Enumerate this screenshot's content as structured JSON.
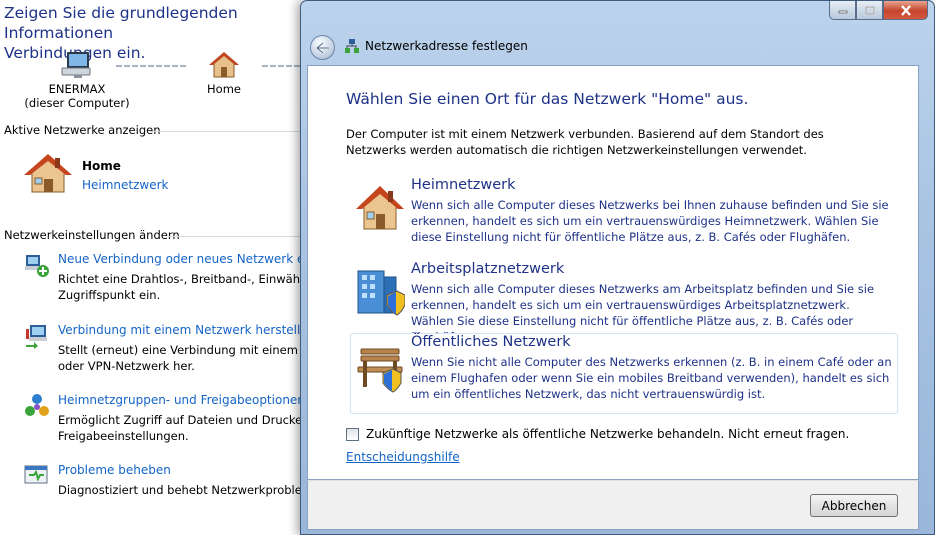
{
  "background": {
    "heading": "Zeigen Sie die grundlegenden Informationen ... Verbindungen ein.",
    "heading_line1": "Zeigen Sie die grundlegenden Informationen",
    "heading_line2": "Verbindungen ein.",
    "map": {
      "computer_name": "ENERMAX",
      "computer_sub": "(dieser Computer)",
      "network_name": "Home"
    },
    "active_networks_label": "Aktive Netzwerke anzeigen",
    "active_network": {
      "name": "Home",
      "type": "Heimnetzwerk"
    },
    "change_settings_label": "Netzwerkeinstellungen ändern",
    "tasks": [
      {
        "title": "Neue Verbindung oder neues Netzwerk einrichten",
        "line1": "Richtet eine Drahtlos-, Breitband-, Einwähl-, Ad-hoc- oder VPN-Verbindung bzw. einen Router oder",
        "line2": "Zugriffspunkt ein.",
        "icon": "new-connection-icon"
      },
      {
        "title": "Verbindung mit einem Netzwerk herstellen",
        "line1": "Stellt (erneut) eine Verbindung mit einem Drahtlos-, Kabel-, Einwähl-",
        "line2": "oder VPN-Netzwerk her.",
        "icon": "connect-network-icon"
      },
      {
        "title": "Heimnetzgruppen- und Freigabeoptionen auswählen",
        "line1": "Ermöglicht Zugriff auf Dateien und Drucker auf anderen Computern oder",
        "line2": "Freigabeeinstellungen.",
        "icon": "homegroup-icon"
      },
      {
        "title": "Probleme beheben",
        "line1": "Diagnostiziert und behebt Netzwerkprobleme,",
        "line2": "",
        "icon": "troubleshoot-icon"
      }
    ]
  },
  "dialog": {
    "caption": "Netzwerkadresse festlegen",
    "title": "Wählen Sie einen Ort für das Netzwerk \"Home\" aus.",
    "intro": "Der Computer ist mit einem Netzwerk verbunden. Basierend auf dem Standort des Netzwerks werden automatisch die richtigen Netzwerkeinstellungen verwendet.",
    "locations": [
      {
        "title": "Heimnetzwerk",
        "description": "Wenn sich alle Computer dieses Netzwerks bei Ihnen zuhause befinden und Sie sie erkennen, handelt es sich um ein vertrauenswürdiges Heimnetzwerk. Wählen Sie diese Einstellung nicht für öffentliche Plätze aus, z. B. Cafés oder Flughäfen.",
        "icon": "home-icon"
      },
      {
        "title": "Arbeitsplatznetzwerk",
        "description": "Wenn sich alle Computer dieses Netzwerks am Arbeitsplatz befinden und Sie sie erkennen, handelt es sich um ein vertrauenswürdiges Arbeitsplatznetzwerk. Wählen Sie diese Einstellung nicht für öffentliche Plätze aus, z. B. Cafés oder Flughäfen.",
        "icon": "office-building-icon"
      },
      {
        "title": "Öffentliches Netzwerk",
        "description": "Wenn Sie nicht alle Computer des Netzwerks erkennen (z. B. in einem Café oder an einem Flughafen oder wenn Sie ein mobiles Breitband verwenden), handelt es sich um ein öffentliches Netzwerk, das nicht vertrauenswürdig ist.",
        "icon": "park-bench-icon"
      }
    ],
    "checkbox_label": "Zukünftige Netzwerke als öffentliche Netzwerke behandeln. Nicht erneut fragen.",
    "checkbox_checked": false,
    "help_link": "Entscheidungshilfe",
    "cancel_button": "Abbrechen"
  },
  "colors": {
    "link": "#1464c8",
    "heading": "#1e3287",
    "frame": "#a9c4e3"
  }
}
